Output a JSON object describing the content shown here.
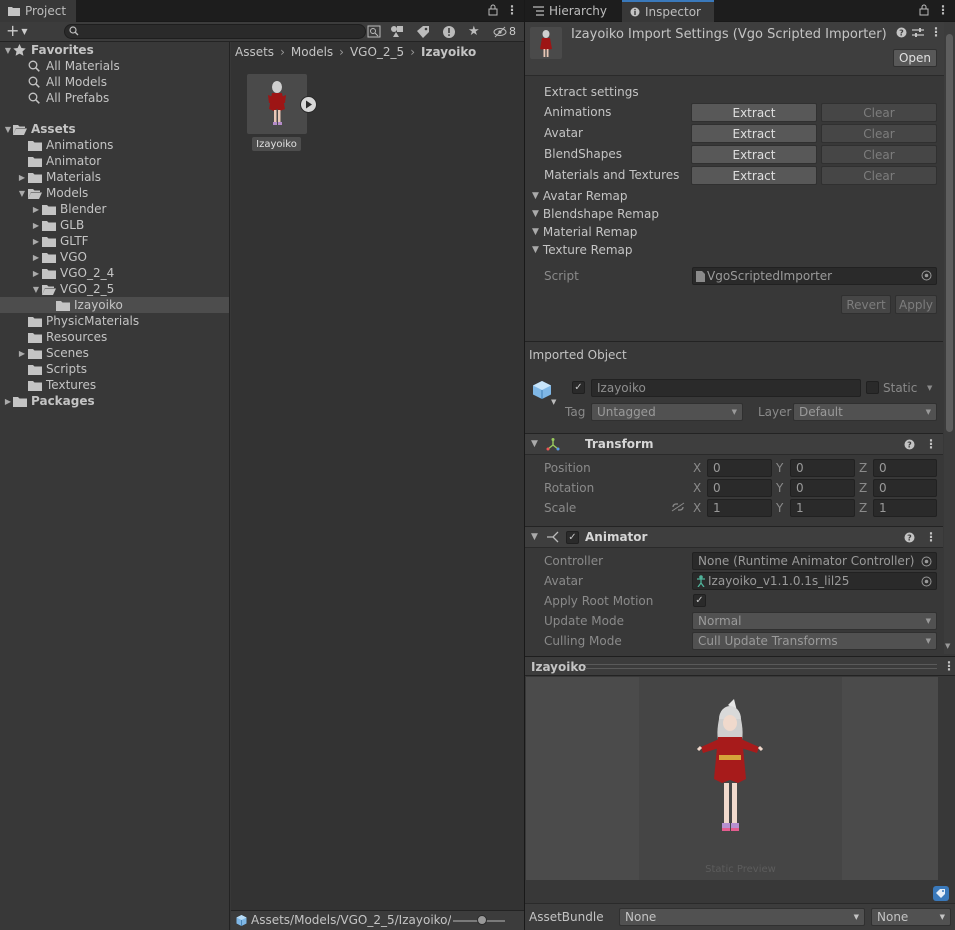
{
  "project": {
    "tab_label": "Project",
    "search_placeholder": "",
    "hidden_count": "8",
    "tree": [
      {
        "label": "Favorites",
        "depth": 0,
        "kind": "star",
        "arrow": "down",
        "bold": true
      },
      {
        "label": "All Materials",
        "depth": 1,
        "kind": "search",
        "arrow": "none"
      },
      {
        "label": "All Models",
        "depth": 1,
        "kind": "search",
        "arrow": "none"
      },
      {
        "label": "All Prefabs",
        "depth": 1,
        "kind": "search",
        "arrow": "none"
      },
      {
        "label": "",
        "depth": 0,
        "kind": "spacer",
        "arrow": "none"
      },
      {
        "label": "Assets",
        "depth": 0,
        "kind": "folder-open",
        "arrow": "down",
        "bold": true
      },
      {
        "label": "Animations",
        "depth": 1,
        "kind": "folder",
        "arrow": "none"
      },
      {
        "label": "Animator",
        "depth": 1,
        "kind": "folder",
        "arrow": "none"
      },
      {
        "label": "Materials",
        "depth": 1,
        "kind": "folder",
        "arrow": "right"
      },
      {
        "label": "Models",
        "depth": 1,
        "kind": "folder-open",
        "arrow": "down"
      },
      {
        "label": "Blender",
        "depth": 2,
        "kind": "folder",
        "arrow": "right"
      },
      {
        "label": "GLB",
        "depth": 2,
        "kind": "folder",
        "arrow": "right"
      },
      {
        "label": "GLTF",
        "depth": 2,
        "kind": "folder",
        "arrow": "right"
      },
      {
        "label": "VGO",
        "depth": 2,
        "kind": "folder",
        "arrow": "right"
      },
      {
        "label": "VGO_2_4",
        "depth": 2,
        "kind": "folder",
        "arrow": "right"
      },
      {
        "label": "VGO_2_5",
        "depth": 2,
        "kind": "folder-open",
        "arrow": "down"
      },
      {
        "label": "Izayoiko",
        "depth": 3,
        "kind": "folder",
        "arrow": "none",
        "selected": true
      },
      {
        "label": "PhysicMaterials",
        "depth": 1,
        "kind": "folder",
        "arrow": "none"
      },
      {
        "label": "Resources",
        "depth": 1,
        "kind": "folder",
        "arrow": "none"
      },
      {
        "label": "Scenes",
        "depth": 1,
        "kind": "folder",
        "arrow": "right"
      },
      {
        "label": "Scripts",
        "depth": 1,
        "kind": "folder",
        "arrow": "none"
      },
      {
        "label": "Textures",
        "depth": 1,
        "kind": "folder",
        "arrow": "none"
      },
      {
        "label": "Packages",
        "depth": 0,
        "kind": "folder",
        "arrow": "right",
        "bold": true
      }
    ],
    "breadcrumbs": [
      "Assets",
      "Models",
      "VGO_2_5",
      "Izayoiko"
    ],
    "asset_label": "Izayoiko",
    "status_path": "Assets/Models/VGO_2_5/Izayoiko/Iz"
  },
  "inspector": {
    "tabs": {
      "hierarchy": "Hierarchy",
      "inspector": "Inspector"
    },
    "title": "Izayoiko Import Settings (Vgo Scripted Importer)",
    "open_label": "Open",
    "extract_header": "Extract settings",
    "extract_rows": [
      {
        "label": "Animations",
        "extract": "Extract",
        "clear": "Clear"
      },
      {
        "label": "Avatar",
        "extract": "Extract",
        "clear": "Clear"
      },
      {
        "label": "BlendShapes",
        "extract": "Extract",
        "clear": "Clear"
      },
      {
        "label": "Materials and Textures",
        "extract": "Extract",
        "clear": "Clear"
      }
    ],
    "remaps": [
      "Avatar Remap",
      "Blendshape Remap",
      "Material Remap",
      "Texture Remap"
    ],
    "script_label": "Script",
    "script_value": "VgoScriptedImporter",
    "revert_label": "Revert",
    "apply_label": "Apply",
    "imported_object_label": "Imported Object",
    "object_name": "Izayoiko",
    "static_label": "Static",
    "tag_label": "Tag",
    "tag_value": "Untagged",
    "layer_label": "Layer",
    "layer_value": "Default",
    "transform": {
      "title": "Transform",
      "rows": [
        {
          "label": "Position",
          "x": "0",
          "y": "0",
          "z": "0"
        },
        {
          "label": "Rotation",
          "x": "0",
          "y": "0",
          "z": "0"
        },
        {
          "label": "Scale",
          "x": "1",
          "y": "1",
          "z": "1"
        }
      ],
      "axes": {
        "x": "X",
        "y": "Y",
        "z": "Z"
      }
    },
    "animator": {
      "title": "Animator",
      "controller_label": "Controller",
      "controller_value": "None (Runtime Animator Controller)",
      "avatar_label": "Avatar",
      "avatar_value": "Izayoiko_v1.1.0.1s_lil25",
      "root_motion_label": "Apply Root Motion",
      "update_mode_label": "Update Mode",
      "update_mode_value": "Normal",
      "culling_mode_label": "Culling Mode",
      "culling_mode_value": "Cull Update Transforms"
    },
    "preview_title": "Izayoiko",
    "preview_caption": "Static Preview",
    "assetbundle_label": "AssetBundle",
    "assetbundle_value": "None",
    "assetbundle_variant": "None"
  }
}
